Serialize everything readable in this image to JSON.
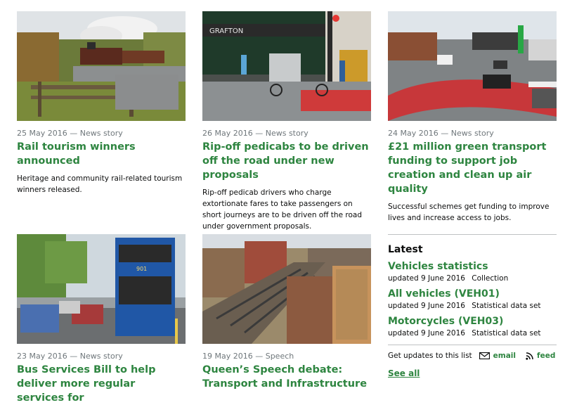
{
  "cards": [
    {
      "meta": "25 May 2016 — News story",
      "title": "Rail tourism winners announced",
      "desc": "Heritage and community rail-related tourism winners released."
    },
    {
      "meta": "26 May 2016 — News story",
      "title": "Rip-off pedicabs to be driven off the road under new proposals",
      "desc": "Rip-off pedicab drivers who charge extortionate fares to take passengers on short journeys are to be driven off the road under government proposals."
    },
    {
      "meta": "24 May 2016 — News story",
      "title": "£21 million green transport funding to support job creation and clean up air quality",
      "desc": "Successful schemes get funding to improve lives and increase access to jobs."
    },
    {
      "meta": "23 May 2016 — News story",
      "title": "Bus Services Bill to help deliver more regular services for"
    },
    {
      "meta": "19 May 2016 — Speech",
      "title": "Queen’s Speech debate: Transport and Infrastructure"
    }
  ],
  "images": {
    "shop_sign": "GRAFTON",
    "bus_route": "901"
  },
  "latest": {
    "heading": "Latest",
    "items": [
      {
        "title": "Vehicles statistics",
        "updated": "updated 9 June 2016",
        "type": "Collection"
      },
      {
        "title": "All vehicles (VEH01)",
        "updated": "updated 9 June 2016",
        "type": "Statistical data set"
      },
      {
        "title": "Motorcycles (VEH03)",
        "updated": "updated 9 June 2016",
        "type": "Statistical data set"
      }
    ],
    "updates_label": "Get updates to this list",
    "email_label": "email",
    "feed_label": "feed",
    "see_all": "See all"
  },
  "colors": {
    "link_green": "#2e8540",
    "meta_grey": "#6f777b",
    "divider": "#bfc1c3"
  }
}
